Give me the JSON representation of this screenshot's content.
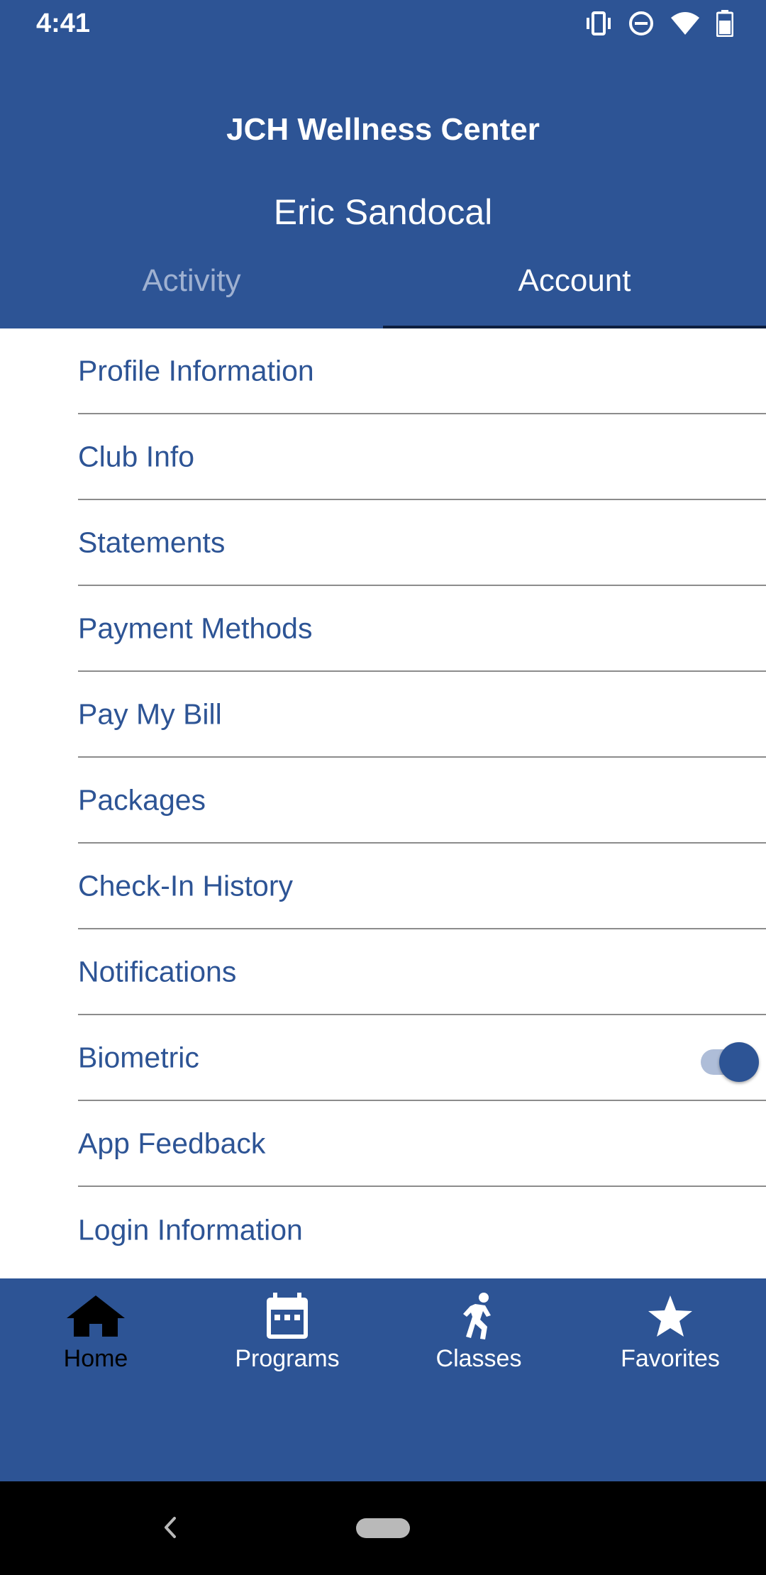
{
  "status_bar": {
    "time": "4:41",
    "icons": [
      "vibrate-icon",
      "do-not-disturb-icon",
      "wifi-icon",
      "battery-icon"
    ]
  },
  "header": {
    "app_title": "JCH Wellness Center",
    "user_name": "Eric Sandocal"
  },
  "tabs": [
    {
      "label": "Activity",
      "active": false
    },
    {
      "label": "Account",
      "active": true
    }
  ],
  "menu": {
    "items": [
      {
        "label": "Profile Information"
      },
      {
        "label": "Club Info"
      },
      {
        "label": "Statements"
      },
      {
        "label": "Payment Methods"
      },
      {
        "label": "Pay My Bill"
      },
      {
        "label": "Packages"
      },
      {
        "label": "Check-In History"
      },
      {
        "label": "Notifications"
      },
      {
        "label": "Biometric",
        "toggle": true
      },
      {
        "label": "App Feedback"
      },
      {
        "label": "Login Information"
      }
    ]
  },
  "bottom_nav": {
    "items": [
      {
        "label": "Home",
        "icon": "home-icon",
        "active": true
      },
      {
        "label": "Programs",
        "icon": "calendar-icon",
        "active": false
      },
      {
        "label": "Classes",
        "icon": "running-person-icon",
        "active": false
      },
      {
        "label": "Favorites",
        "icon": "star-icon",
        "active": false
      }
    ]
  },
  "colors": {
    "primary": "#2d5495",
    "inactive_tab": "#9fb1d1",
    "divider": "#8c8c8c",
    "toggle_track": "#aebdd8"
  }
}
